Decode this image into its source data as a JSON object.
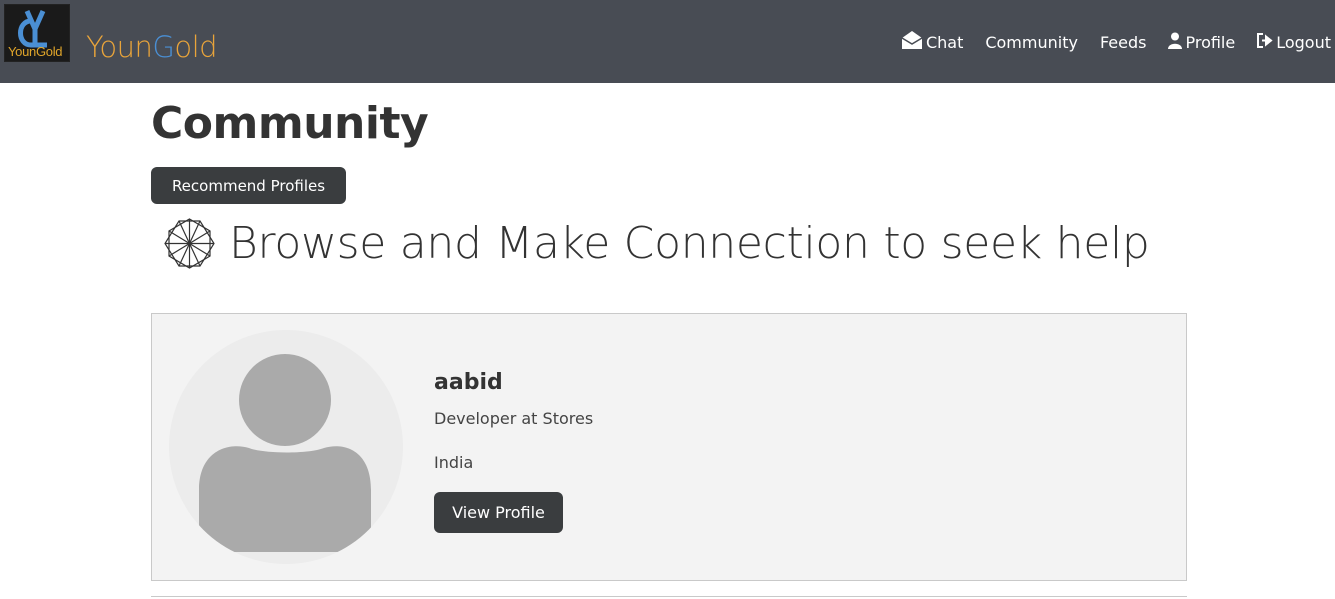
{
  "header": {
    "logo_caption": "YounGold",
    "brand_part1": "Youn",
    "brand_part2": "G",
    "brand_part3": "old",
    "brand_color": "#e9a43a",
    "brand_accent": "#4a8fd4",
    "nav": [
      {
        "label": "Chat",
        "icon": "envelope-open-icon"
      },
      {
        "label": "Community",
        "icon": ""
      },
      {
        "label": "Feeds",
        "icon": ""
      },
      {
        "label": "Profile",
        "icon": "user-icon"
      },
      {
        "label": "Logout",
        "icon": "logout-icon"
      }
    ]
  },
  "main": {
    "title": "Community",
    "recommend_button": "Recommend Profiles",
    "browse_heading": "Browse and Make Connection to seek help",
    "browse_icon": "network-hexagon-icon"
  },
  "profiles": [
    {
      "name": "aabid",
      "role": "Developer at Stores",
      "location": "India",
      "button": "View Profile",
      "avatar_icon": "default-avatar-icon"
    }
  ]
}
